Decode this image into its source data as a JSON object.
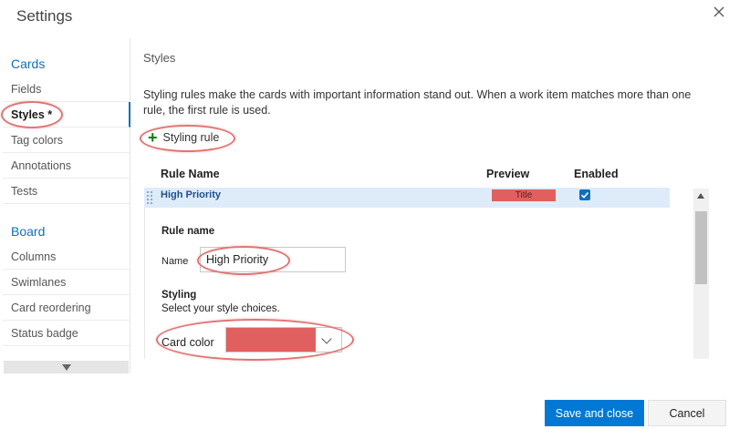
{
  "dialog": {
    "title": "Settings",
    "close_icon": "close-icon"
  },
  "sidebar": {
    "cards_section": "Cards",
    "cards_items": [
      {
        "label": "Fields",
        "selected": false
      },
      {
        "label": "Styles *",
        "selected": true
      },
      {
        "label": "Tag colors",
        "selected": false
      },
      {
        "label": "Annotations",
        "selected": false
      },
      {
        "label": "Tests",
        "selected": false
      }
    ],
    "board_section": "Board",
    "board_items": [
      {
        "label": "Columns"
      },
      {
        "label": "Swimlanes"
      },
      {
        "label": "Card reordering"
      },
      {
        "label": "Status badge"
      }
    ]
  },
  "main": {
    "heading": "Styles",
    "description": "Styling rules make the cards with important information stand out. When a work item matches more than one rule, the first rule is used.",
    "add_rule_label": "Styling rule",
    "columns": {
      "rule_name": "Rule Name",
      "preview": "Preview",
      "enabled": "Enabled"
    },
    "rules": [
      {
        "name": "High Priority",
        "preview_text": "Title",
        "preview_color": "#e06060",
        "enabled": true
      }
    ],
    "editor": {
      "rule_name_heading": "Rule name",
      "name_label": "Name",
      "name_value": "High Priority",
      "styling_heading": "Styling",
      "styling_hint": "Select your style choices.",
      "card_color_label": "Card color",
      "card_color_value": "#e06060"
    }
  },
  "footer": {
    "save_label": "Save and close",
    "cancel_label": "Cancel"
  },
  "colors": {
    "accent": "#0078d4",
    "annotation": "#e07575",
    "selection": "#deecf9"
  }
}
